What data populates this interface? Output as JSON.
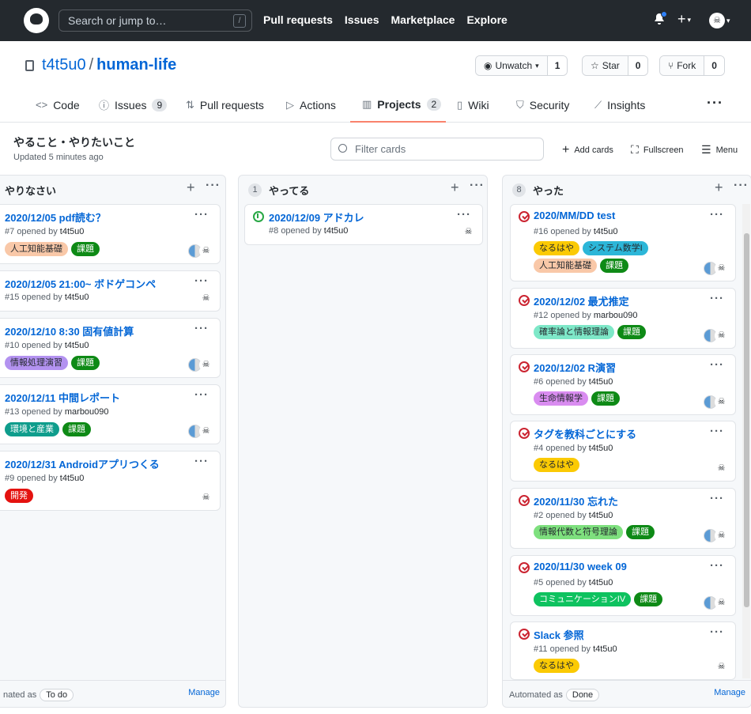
{
  "header": {
    "search_placeholder": "Search or jump to…",
    "search_key": "/",
    "nav": [
      "Pull requests",
      "Issues",
      "Marketplace",
      "Explore"
    ]
  },
  "repo": {
    "owner": "t4t5u0",
    "separator": "/",
    "name": "human-life",
    "watch": {
      "label": "Unwatch",
      "count": "1"
    },
    "star": {
      "label": "Star",
      "count": "0"
    },
    "fork": {
      "label": "Fork",
      "count": "0"
    }
  },
  "tabs": [
    {
      "label": "Code",
      "icon": "code-icon"
    },
    {
      "label": "Issues",
      "icon": "issue-icon",
      "count": "9"
    },
    {
      "label": "Pull requests",
      "icon": "pr-icon"
    },
    {
      "label": "Actions",
      "icon": "play-icon"
    },
    {
      "label": "Projects",
      "icon": "project-icon",
      "count": "2"
    },
    {
      "label": "Wiki",
      "icon": "book-icon"
    },
    {
      "label": "Security",
      "icon": "shield-icon"
    },
    {
      "label": "Insights",
      "icon": "graph-icon"
    }
  ],
  "project": {
    "name": "やること・やりたいこと",
    "updated": "Updated 5 minutes ago",
    "filter_placeholder": "Filter cards",
    "add_cards": "Add cards",
    "fullscreen": "Fullscreen",
    "menu": "Menu"
  },
  "columns": [
    {
      "title": "やりなさい",
      "footer_text": "nated as",
      "footer_badge": "To do",
      "manage": "Manage",
      "cards": [
        {
          "title": "2020/12/05 pdf読む？",
          "number": "#7",
          "opened": "opened by",
          "author": "t4t5u0",
          "labels": [
            {
              "text": "人工知能基礎",
              "color": "#f9c8a8"
            },
            {
              "text": "課題",
              "color": "#0e8a16",
              "dark": true
            }
          ]
        },
        {
          "title": "2020/12/05 21:00~ ボドゲコンペ",
          "number": "#15",
          "opened": "opened by",
          "author": "t4t5u0",
          "labels": []
        },
        {
          "title": "2020/12/10 8:30 固有値計算",
          "number": "#10",
          "opened": "opened by",
          "author": "t4t5u0",
          "labels": [
            {
              "text": "情報処理演習",
              "color": "#b392f0"
            },
            {
              "text": "課題",
              "color": "#0e8a16",
              "dark": true
            }
          ]
        },
        {
          "title": "2020/12/11 中間レポート",
          "number": "#13",
          "opened": "opened by",
          "author": "marbou090",
          "labels": [
            {
              "text": "環境と産業",
              "color": "#0f9d8c",
              "dark": true
            },
            {
              "text": "課題",
              "color": "#0e8a16",
              "dark": true
            }
          ]
        },
        {
          "title": "2020/12/31 Androidアプリつくる",
          "number": "#9",
          "opened": "opened by",
          "author": "t4t5u0",
          "labels": [
            {
              "text": "開発",
              "color": "#e4120f",
              "dark": true
            }
          ]
        }
      ]
    },
    {
      "count": "1",
      "title": "やってる",
      "cards": [
        {
          "title": "2020/12/09 アドカレ",
          "number": "#8",
          "opened": "opened by",
          "author": "t4t5u0",
          "labels": []
        }
      ]
    },
    {
      "count": "8",
      "title": "やった",
      "footer_text": "Automated as",
      "footer_badge": "Done",
      "manage": "Manage",
      "cards": [
        {
          "title": "2020/MM/DD test",
          "number": "#16",
          "opened": "opened by",
          "author": "t4t5u0",
          "labels": [
            {
              "text": "なるはや",
              "color": "#fbca04"
            },
            {
              "text": "システム数学I",
              "color": "#2cb6d8"
            },
            {
              "text": "人工知能基礎",
              "color": "#f9c8a8"
            },
            {
              "text": "課題",
              "color": "#0e8a16",
              "dark": true
            }
          ]
        },
        {
          "title": "2020/12/02 最尤推定",
          "number": "#12",
          "opened": "opened by",
          "author": "marbou090",
          "labels": [
            {
              "text": "確率論と情報理論",
              "color": "#7ee8c8"
            },
            {
              "text": "課題",
              "color": "#0e8a16",
              "dark": true
            }
          ]
        },
        {
          "title": "2020/12/02 R演習",
          "number": "#6",
          "opened": "opened by",
          "author": "t4t5u0",
          "labels": [
            {
              "text": "生命情報学",
              "color": "#d98cf0"
            },
            {
              "text": "課題",
              "color": "#0e8a16",
              "dark": true
            }
          ]
        },
        {
          "title": "タグを教科ごとにする",
          "number": "#4",
          "opened": "opened by",
          "author": "t4t5u0",
          "labels": [
            {
              "text": "なるはや",
              "color": "#fbca04"
            }
          ]
        },
        {
          "title": "2020/11/30 忘れた",
          "number": "#2",
          "opened": "opened by",
          "author": "t4t5u0",
          "labels": [
            {
              "text": "情報代数と符号理論",
              "color": "#7ee07e"
            },
            {
              "text": "課題",
              "color": "#0e8a16",
              "dark": true
            }
          ]
        },
        {
          "title": "2020/11/30 week 09",
          "number": "#5",
          "opened": "opened by",
          "author": "t4t5u0",
          "labels": [
            {
              "text": "コミュニケーションIV",
              "color": "#0ec25f",
              "dark": true
            },
            {
              "text": "課題",
              "color": "#0e8a16",
              "dark": true
            }
          ]
        },
        {
          "title": "Slack 参照",
          "number": "#11",
          "opened": "opened by",
          "author": "t4t5u0",
          "labels": [
            {
              "text": "なるはや",
              "color": "#fbca04"
            }
          ]
        }
      ]
    }
  ]
}
